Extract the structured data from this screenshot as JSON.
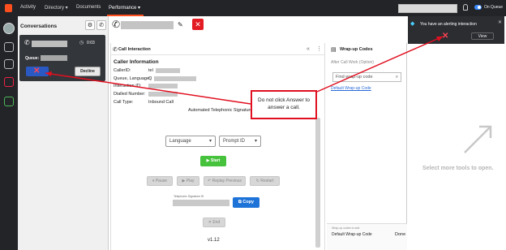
{
  "topnav": {
    "items": [
      "Activity",
      "Directory ▾",
      "Documents",
      "Performance ▾"
    ],
    "on_queue_label": "On Queue"
  },
  "conversations": {
    "title": "Conversations",
    "call": {
      "timer": "0:03",
      "queue_label": "Queue:",
      "decline_label": "Decline"
    }
  },
  "call_interaction": {
    "header": "Call Interaction",
    "section_title": "Caller Information",
    "fields": [
      {
        "label": "CallerID:",
        "value": "tel"
      },
      {
        "label": "Queue, Language:",
        "value": "Q"
      },
      {
        "label": "Interaction ID:",
        "value": ""
      },
      {
        "label": "Dialled Number:",
        "value": ""
      },
      {
        "label": "Call Type:",
        "value": "Inbound Call"
      }
    ],
    "signature_label": "Automated Telephonic Signature",
    "language_placeholder": "Language",
    "prompt_placeholder": "Prompt ID",
    "start_label": "Start",
    "pause_label": "Pause",
    "play_label": "Play",
    "replay_label": "Replay Previous",
    "restart_label": "Restart",
    "sig_id_label": "Telephonic Signature ID",
    "copy_label": "Copy",
    "end_label": "End",
    "version": "v1.12"
  },
  "callout_text": "Do not click Answer to answer a call.",
  "wrapup": {
    "header": "Wrap-up Codes",
    "after_call_label": "After Call Work (Option)",
    "search_placeholder": "Find wrap-up code",
    "default_link": "Default Wrap-up Code",
    "footer_caption": "Wrap-up codes to add",
    "footer_value": "Default Wrap-up Code",
    "done_label": "Done"
  },
  "notification": {
    "title": "You have an alerting interaction",
    "view_label": "View"
  },
  "more_tools_text": "Select more tools to open.",
  "colors": {
    "accent": "#ff4f1f",
    "answer_blue": "#2b59c3",
    "start_green": "#46c23c",
    "danger_red": "#e01020"
  }
}
